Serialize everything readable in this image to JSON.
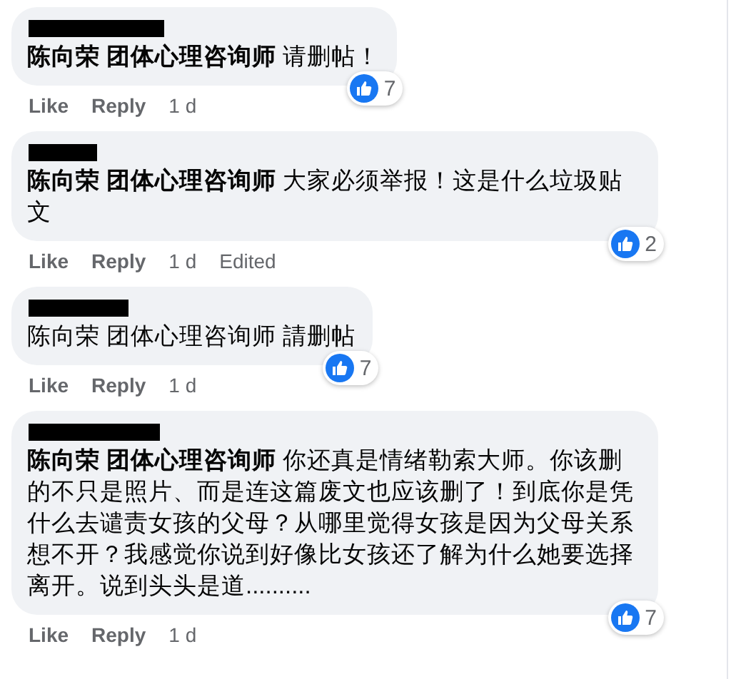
{
  "comments": [
    {
      "text": "**陈向荣 团体心理咨询师** 请删帖！",
      "reaction_count": "7",
      "actions": [
        "Like",
        "Reply"
      ],
      "time": "1 d"
    },
    {
      "text": "**陈向荣 团体心理咨询师** 大家必须举报！这是什么垃圾贴文",
      "reaction_count": "2",
      "actions": [
        "Like",
        "Reply"
      ],
      "time": "1 d",
      "note": "Edited"
    },
    {
      "text": "陈向荣 团体心理咨询师 請删帖",
      "reaction_count": "7",
      "actions": [
        "Like",
        "Reply"
      ],
      "time": "1 d"
    },
    {
      "text": "**陈向荣 团体心理咨询师** 你还真是情绪勒索大师。你该删的不只是照片、而是连这篇废文也应该删了！到底你是凭什么去谴责女孩的父母？从哪里觉得女孩是因为父母关系想不开？我感觉你说到好像比女孩还了解为什么她要选择离开。说到头头是道..........",
      "reaction_count": "7",
      "actions": [
        "Like",
        "Reply"
      ],
      "time": "1 d"
    }
  ]
}
